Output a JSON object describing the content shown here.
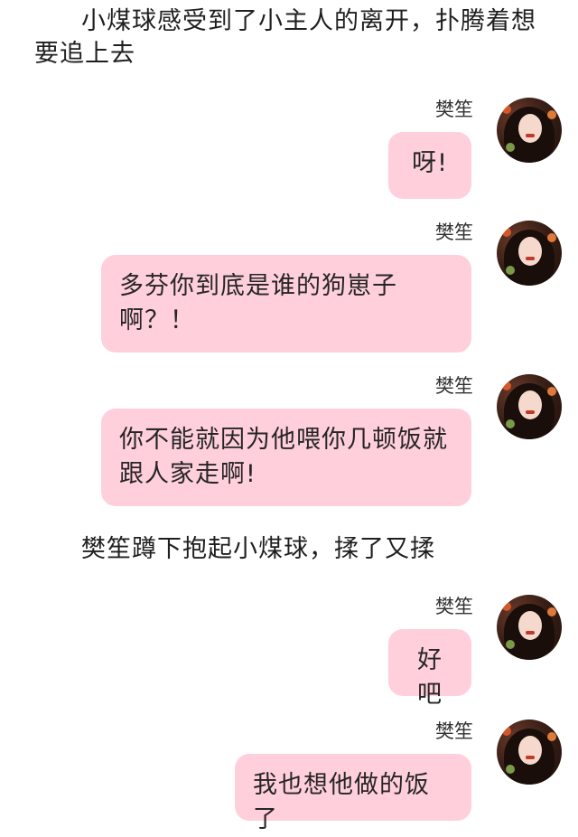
{
  "narration": [
    "小煤球感受到了小主人的离开，扑腾着想要追上去",
    "樊笙蹲下抱起小煤球，揉了又揉"
  ],
  "sender_name": "樊笙",
  "messages": [
    {
      "text": "呀!"
    },
    {
      "text": "多芬你到底是谁的狗崽子啊？！"
    },
    {
      "text": "你不能就因为他喂你几顿饭就跟人家走啊!"
    },
    {
      "text": "好吧"
    },
    {
      "text": "我也想他做的饭了"
    }
  ],
  "colors": {
    "bubble": "#ffcfdc",
    "background": "#ffffff"
  }
}
